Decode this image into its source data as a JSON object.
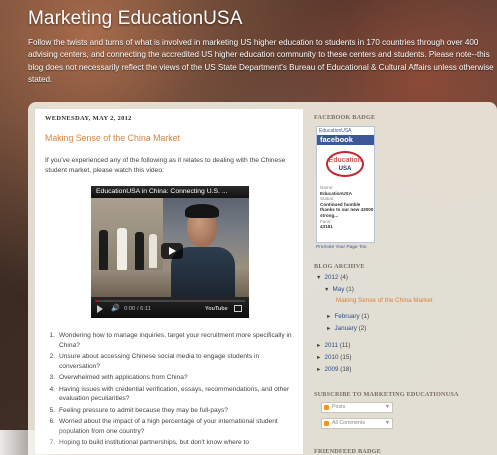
{
  "header": {
    "title": "Marketing EducationUSA",
    "description": "Follow the twists and turns of what is involved in marketing US higher education to students in 170 countries through over 400 advising centers, and connecting the accredited US higher education community to these centers and students. Please note--this blog does not necessarily reflect the views of the US State Department's Bureau of Educational & Cultural Affairs unless otherwise stated."
  },
  "post": {
    "date": "WEDNESDAY, MAY 2, 2012",
    "title": "Making Sense of the China Market",
    "intro": "If you've experienced any of the following as it relates to dealing with the Chinese student market, please watch this video:",
    "video": {
      "title": "EducationUSA in China: Connecting U.S. ...",
      "time": "0:00 / 6:11",
      "logo": "YouTube",
      "volume_icon": "speaker-icon"
    },
    "items": [
      {
        "n": "1.",
        "text": "Wondering how to manage inquiries, target your recruitment more specifically in China?"
      },
      {
        "n": "2.",
        "text": "Unsure about accessing Chinese social media to engage students in conversation?"
      },
      {
        "n": "3.",
        "text": "Overwhelmed with applications from China?"
      },
      {
        "n": "4.",
        "text": "Having issues with credential verification, essays, recommendations, and other evaluation peculiarities?"
      },
      {
        "n": "5.",
        "text": "Feeling pressure to admit because they may be full-pays?"
      },
      {
        "n": "6.",
        "text": "Worried about the impact of a high percentage of your international student population from one country?"
      },
      {
        "n": "7.",
        "text": "Hoping to build institutional partnerships, but don't know where to"
      }
    ]
  },
  "sidebar": {
    "facebook": {
      "heading": "FACEBOOK BADGE",
      "page_name": "EducationUSA",
      "brand": "facebook",
      "logo_text": "Education",
      "logo_sub": "USA",
      "name_label": "Name:",
      "name": "EducationUSA",
      "status_label": "Status:",
      "status": "Continued humble thanks to our new 43000 strong...",
      "fans_label": "Fans:",
      "fans": "43151",
      "promote": "Promote Your Page Too"
    },
    "archive": {
      "heading": "BLOG ARCHIVE",
      "year_2012": "2012",
      "count_2012": "(4)",
      "may": "May",
      "count_may": "(1)",
      "post_link": "Making Sense of the China Market",
      "february": "February",
      "count_feb": "(1)",
      "january": "January",
      "count_jan": "(2)",
      "year_2011": "2011",
      "count_2011": "(11)",
      "year_2010": "2010",
      "count_2010": "(15)",
      "year_2009": "2009",
      "count_2009": "(18)"
    },
    "subscribe": {
      "heading": "SUBSCRIBE TO MARKETING EDUCATIONUSA",
      "posts": "Posts",
      "comments": "All Comments"
    },
    "friendfeed": {
      "heading": "FRIENDFEED BADGE"
    }
  }
}
